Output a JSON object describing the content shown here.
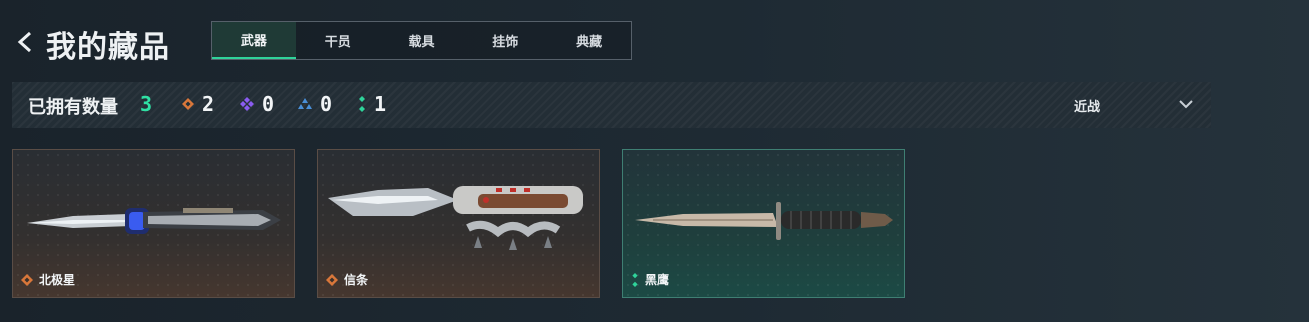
{
  "page": {
    "title": "我的藏品"
  },
  "tabs": [
    {
      "label": "武器",
      "active": true
    },
    {
      "label": "干员",
      "active": false
    },
    {
      "label": "载具",
      "active": false
    },
    {
      "label": "挂饰",
      "active": false
    },
    {
      "label": "典藏",
      "active": false
    }
  ],
  "stats": {
    "owned_label": "已拥有数量",
    "owned_count": "3",
    "rarities": [
      {
        "icon": "orange-diamond-icon",
        "color": "#d9773a",
        "count": "2"
      },
      {
        "icon": "purple-diamond-icon",
        "color": "#8a5cf0",
        "count": "0"
      },
      {
        "icon": "blue-triangle-icon",
        "color": "#4a90d9",
        "count": "0"
      },
      {
        "icon": "green-dots-icon",
        "color": "#2fd39a",
        "count": "1"
      }
    ]
  },
  "filter": {
    "selected": "近战"
  },
  "items": [
    {
      "name": "北极星",
      "rarity_icon": "orange-diamond-icon",
      "rarity_color": "#d9773a"
    },
    {
      "name": "信条",
      "rarity_icon": "orange-diamond-icon",
      "rarity_color": "#d9773a"
    },
    {
      "name": "黑鹰",
      "rarity_icon": "green-dots-icon",
      "rarity_color": "#2fd39a"
    }
  ],
  "colors": {
    "accent": "#2fd39a",
    "background": "#1e2a33"
  }
}
